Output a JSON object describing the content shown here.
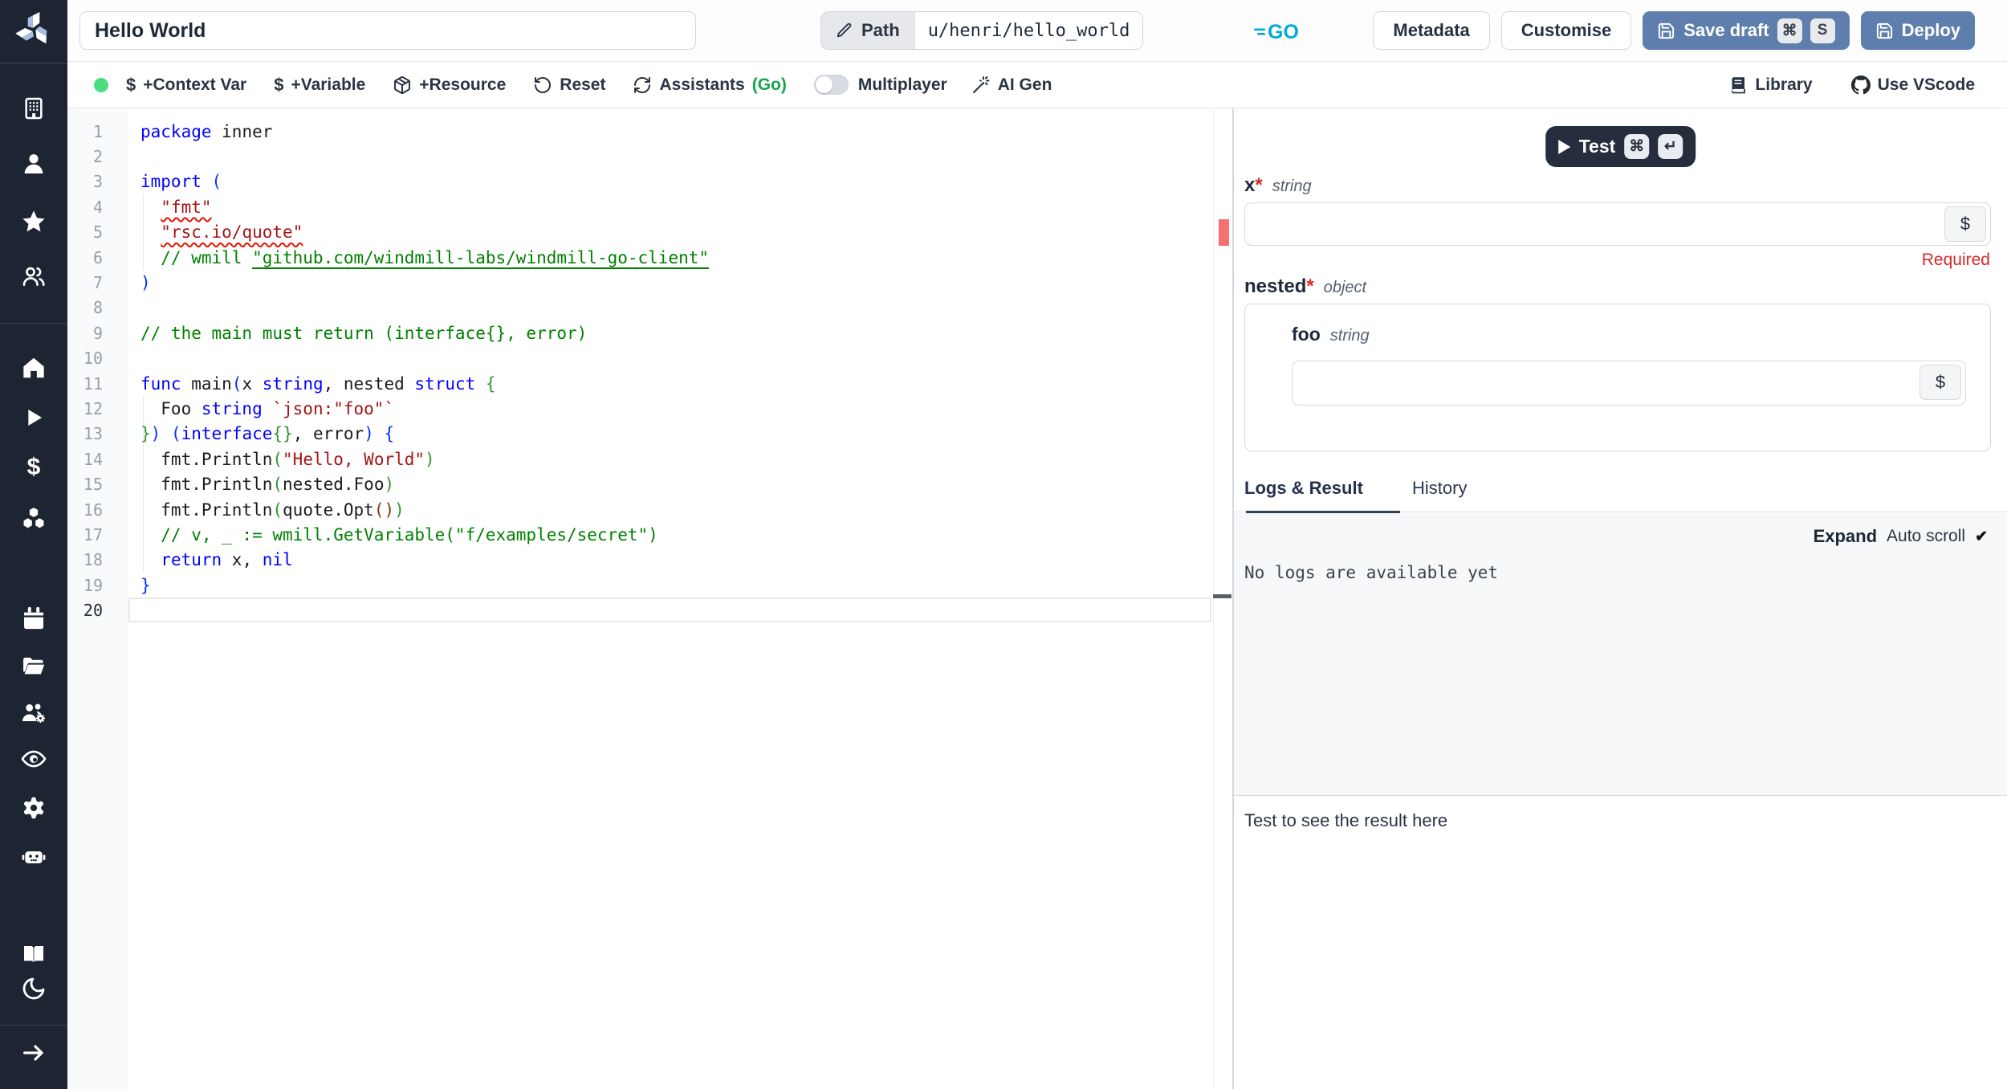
{
  "topbar": {
    "title": "Hello World",
    "path_label": "Path",
    "path_value": "u/henri/hello_world",
    "language_badge": "GO",
    "metadata_label": "Metadata",
    "customise_label": "Customise",
    "save_draft_label": "Save draft",
    "save_kbd_1": "⌘",
    "save_kbd_2": "S",
    "deploy_label": "Deploy"
  },
  "toolbar": {
    "context_var_label": "+Context Var",
    "variable_label": "+Variable",
    "resource_label": "+Resource",
    "reset_label": "Reset",
    "assistants_prefix": "Assistants ",
    "assistants_lang": "(Go)",
    "multiplayer_label": "Multiplayer",
    "ai_gen_label": "AI Gen",
    "library_label": "Library",
    "vscode_label": "Use VScode",
    "dollar_glyph": "$"
  },
  "sidebar": {
    "icons": [
      "windmill-logo",
      "building",
      "user",
      "star",
      "user-group",
      "home",
      "play",
      "dollar",
      "boxes",
      "calendar",
      "folder-open",
      "users-gear",
      "eye",
      "gear",
      "robot",
      "book-open",
      "moon",
      "arrow-right"
    ]
  },
  "editor": {
    "lines": [
      [
        [
          "kw",
          "package"
        ],
        [
          "tx",
          " inner"
        ]
      ],
      [],
      [
        [
          "kw",
          "import"
        ],
        [
          "tx",
          " "
        ],
        [
          "b1",
          "("
        ]
      ],
      [
        [
          "tx",
          "  "
        ],
        [
          "strerr",
          "\"fmt\""
        ]
      ],
      [
        [
          "tx",
          "  "
        ],
        [
          "strerr",
          "\"rsc.io/quote\""
        ]
      ],
      [
        [
          "com",
          "  // wmill "
        ],
        [
          "lnk",
          "\"github.com/windmill-labs/windmill-go-client\""
        ]
      ],
      [
        [
          "b1",
          ")"
        ]
      ],
      [],
      [
        [
          "com",
          "// the main must return (interface{}, error)"
        ]
      ],
      [],
      [
        [
          "kw",
          "func"
        ],
        [
          "tx",
          " main"
        ],
        [
          "b1",
          "("
        ],
        [
          "tx",
          "x "
        ],
        [
          "kw",
          "string"
        ],
        [
          "tx",
          ", nested "
        ],
        [
          "kw",
          "struct"
        ],
        [
          "tx",
          " "
        ],
        [
          "b2",
          "{"
        ]
      ],
      [
        [
          "tx",
          "  Foo "
        ],
        [
          "kw",
          "string"
        ],
        [
          "tx",
          " "
        ],
        [
          "str",
          "`json:\"foo\"`"
        ]
      ],
      [
        [
          "b2",
          "}"
        ],
        [
          "b1",
          ")"
        ],
        [
          "tx",
          " "
        ],
        [
          "b1",
          "("
        ],
        [
          "kw",
          "interface"
        ],
        [
          "b2",
          "{}"
        ],
        [
          "tx",
          ", error"
        ],
        [
          "b1",
          ")"
        ],
        [
          "tx",
          " "
        ],
        [
          "b1",
          "{"
        ]
      ],
      [
        [
          "tx",
          "  fmt.Println"
        ],
        [
          "b2",
          "("
        ],
        [
          "str",
          "\"Hello, World\""
        ],
        [
          "b2",
          ")"
        ]
      ],
      [
        [
          "tx",
          "  fmt.Println"
        ],
        [
          "b2",
          "("
        ],
        [
          "tx",
          "nested.Foo"
        ],
        [
          "b2",
          ")"
        ]
      ],
      [
        [
          "tx",
          "  fmt.Println"
        ],
        [
          "b2",
          "("
        ],
        [
          "tx",
          "quote.Opt"
        ],
        [
          "b3",
          "()"
        ],
        [
          "b2",
          ")"
        ]
      ],
      [
        [
          "com",
          "  // v, _ := wmill.GetVariable(\"f/examples/secret\")"
        ]
      ],
      [
        [
          "tx",
          "  "
        ],
        [
          "kw",
          "return"
        ],
        [
          "tx",
          " x, "
        ],
        [
          "kw",
          "nil"
        ]
      ],
      [
        [
          "b1",
          "}"
        ]
      ],
      []
    ]
  },
  "panel": {
    "test_label": "Test",
    "test_kbd_1": "⌘",
    "test_kbd_2": "↵",
    "form": {
      "x_name": "x",
      "x_star": "*",
      "x_type": "string",
      "required_msg": "Required",
      "nested_name": "nested",
      "nested_star": "*",
      "nested_type": "object",
      "foo_name": "foo",
      "foo_type": "string",
      "dollar": "$"
    },
    "tabs": {
      "logs": "Logs & Result",
      "history": "History"
    },
    "logs": {
      "expand": "Expand",
      "autoscroll": "Auto scroll",
      "check": "✔",
      "empty": "No logs are available yet"
    },
    "result": {
      "placeholder": "Test to see the result here"
    }
  },
  "colors": {
    "sidebar_bg": "#1e2532",
    "primary_button": "#5e7fae",
    "go_logo": "#00acd7",
    "status_green": "#4ade80",
    "required_red": "#dc2626",
    "error_marker": "#f6716f"
  }
}
